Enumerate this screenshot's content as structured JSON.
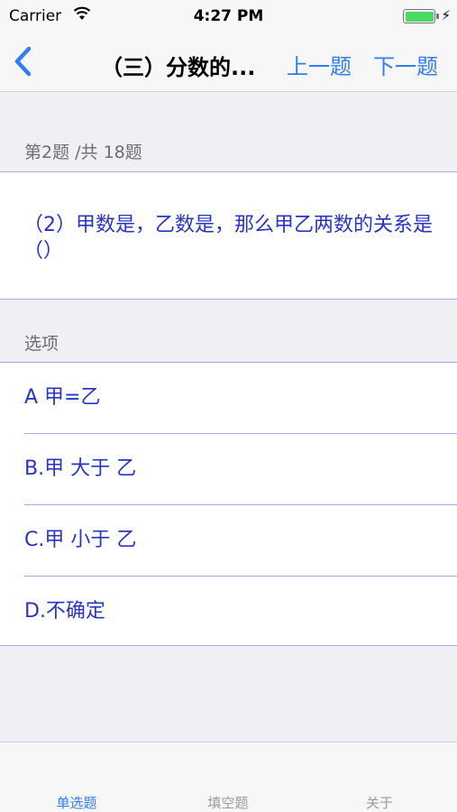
{
  "status": {
    "carrier": "Carrier",
    "time": "4:27 PM",
    "charging_glyph": "⚡",
    "battery_level": 1.0
  },
  "nav": {
    "back_icon": "chevron-left-icon",
    "title": "（三）分数的...",
    "prev_label": "上一题",
    "next_label": "下一题",
    "accent_color": "#2f7ef6"
  },
  "question": {
    "header": "第2题 /共 18题",
    "text": "（2）甲数是，乙数是，那么甲乙两数的关系是（）",
    "text_color": "#2a33c7"
  },
  "options": {
    "header": "选项",
    "items": [
      "A 甲=乙",
      "B.甲 大于 乙",
      "C.甲 小于 乙",
      "D.不确定"
    ]
  },
  "tabs": [
    {
      "label": "单选题",
      "active": true
    },
    {
      "label": "填空题",
      "active": false
    },
    {
      "label": "关于",
      "active": false
    }
  ]
}
